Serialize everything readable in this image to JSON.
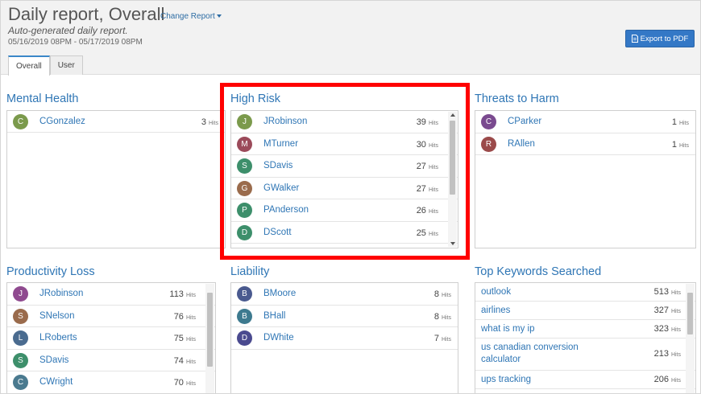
{
  "header": {
    "title": "Daily report, Overall",
    "change_report": "Change Report",
    "subtitle": "Auto-generated daily report.",
    "daterange": "05/16/2019 08PM - 05/17/2019 08PM",
    "export_label": "Export to PDF"
  },
  "tabs": [
    {
      "label": "Overall",
      "active": true
    },
    {
      "label": "User",
      "active": false
    }
  ],
  "hits_unit": "Hits",
  "panels": {
    "mental_health": {
      "title": "Mental Health",
      "rows": [
        {
          "initial": "C",
          "name": "CGonzalez",
          "hits": 3,
          "color": "#7b9a4c"
        }
      ]
    },
    "high_risk": {
      "title": "High Risk",
      "rows": [
        {
          "initial": "J",
          "name": "JRobinson",
          "hits": 39,
          "color": "#7b9a4c"
        },
        {
          "initial": "M",
          "name": "MTurner",
          "hits": 30,
          "color": "#9b4a5a"
        },
        {
          "initial": "S",
          "name": "SDavis",
          "hits": 27,
          "color": "#3d8f6b"
        },
        {
          "initial": "G",
          "name": "GWalker",
          "hits": 27,
          "color": "#9a6b4c"
        },
        {
          "initial": "P",
          "name": "PAnderson",
          "hits": 26,
          "color": "#3d8f6b"
        },
        {
          "initial": "D",
          "name": "DScott",
          "hits": 25,
          "color": "#3d8f6b"
        }
      ]
    },
    "threats": {
      "title": "Threats to Harm",
      "rows": [
        {
          "initial": "C",
          "name": "CParker",
          "hits": 1,
          "color": "#7a4a8f"
        },
        {
          "initial": "R",
          "name": "RAllen",
          "hits": 1,
          "color": "#9b4a4a"
        }
      ]
    },
    "productivity": {
      "title": "Productivity Loss",
      "rows": [
        {
          "initial": "J",
          "name": "JRobinson",
          "hits": 113,
          "color": "#8f4a8f"
        },
        {
          "initial": "S",
          "name": "SNelson",
          "hits": 76,
          "color": "#9a6b4c"
        },
        {
          "initial": "L",
          "name": "LRoberts",
          "hits": 75,
          "color": "#4a6b8f"
        },
        {
          "initial": "S",
          "name": "SDavis",
          "hits": 74,
          "color": "#3d8f6b"
        },
        {
          "initial": "C",
          "name": "CWright",
          "hits": 70,
          "color": "#4a7a8f"
        }
      ]
    },
    "liability": {
      "title": "Liability",
      "rows": [
        {
          "initial": "B",
          "name": "BMoore",
          "hits": 8,
          "color": "#4a5a8f"
        },
        {
          "initial": "B",
          "name": "BHall",
          "hits": 8,
          "color": "#3d7a8f"
        },
        {
          "initial": "D",
          "name": "DWhite",
          "hits": 7,
          "color": "#4a4a8f"
        }
      ]
    },
    "keywords": {
      "title": "Top Keywords Searched",
      "rows": [
        {
          "keyword": "outlook",
          "hits": 513
        },
        {
          "keyword": "airlines",
          "hits": 327
        },
        {
          "keyword": "what is my ip",
          "hits": 323
        },
        {
          "keyword": "us canadian conversion calculator",
          "hits": 213
        },
        {
          "keyword": "ups tracking",
          "hits": 206
        }
      ]
    }
  }
}
